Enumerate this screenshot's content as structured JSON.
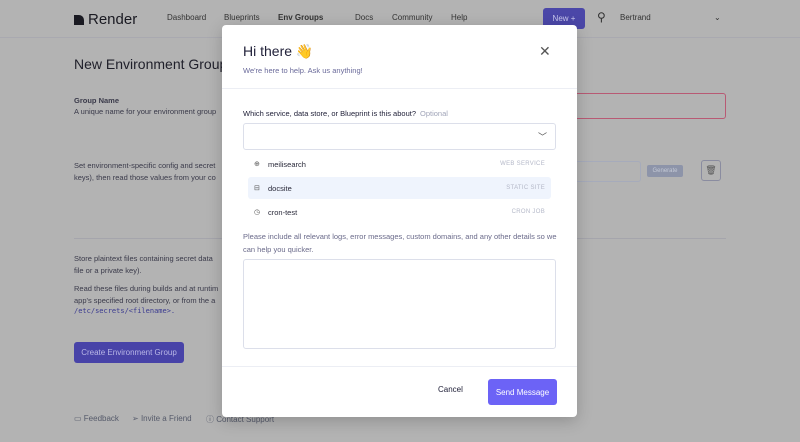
{
  "nav": {
    "brand": "Render",
    "links": [
      "Dashboard",
      "Blueprints",
      "Env Groups",
      "Docs",
      "Community",
      "Help"
    ],
    "new_label": "New +",
    "user": "Bertrand"
  },
  "page": {
    "title": "New Environment Group",
    "group_name_label": "Group Name",
    "group_name_desc": "A unique name for your environment group",
    "env_desc_1": "Set environment-specific config and secret",
    "env_desc_2": "keys), then read those values from your co",
    "generate": "Generate",
    "files_desc_1": "Store plaintext files containing secret data",
    "files_desc_2": "file or a private key).",
    "files_desc_3": "Read these files during builds and at runtim",
    "files_desc_4": "app's specified root directory, or from the a",
    "files_path": "/etc/secrets/<filename>.",
    "create": "Create Environment Group"
  },
  "footer": {
    "feedback": "Feedback",
    "invite": "Invite a Friend",
    "support": "Contact Support"
  },
  "modal": {
    "title": "Hi there 👋",
    "subtitle": "We're here to help. Ask us anything!",
    "question": "Which service, data store, or Blueprint is this about?",
    "optional": "Optional",
    "options": [
      {
        "name": "meilisearch",
        "type": "WEB SERVICE",
        "icon": "globe-icon"
      },
      {
        "name": "docsite",
        "type": "STATIC SITE",
        "icon": "static-site-icon"
      },
      {
        "name": "cron-test",
        "type": "CRON JOB",
        "icon": "clock-icon"
      }
    ],
    "hint": "Please include all relevant logs, error messages, custom domains, and any other details so we can help you quicker.",
    "message_value": "",
    "cancel": "Cancel",
    "send": "Send Message"
  }
}
